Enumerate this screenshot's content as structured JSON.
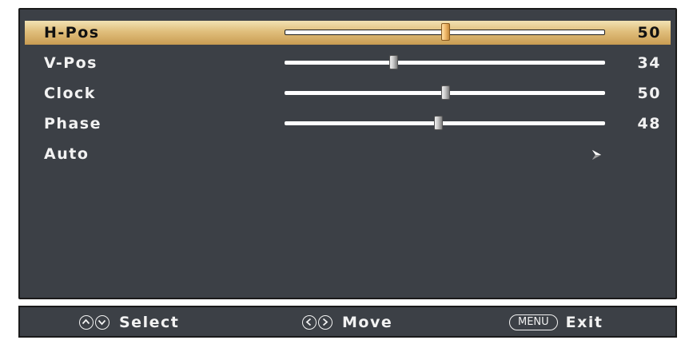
{
  "menu": {
    "rows": [
      {
        "label": "H-Pos",
        "value": "50",
        "level": 50,
        "type": "slider",
        "selected": true
      },
      {
        "label": "V-Pos",
        "value": "34",
        "level": 34,
        "type": "slider",
        "selected": false
      },
      {
        "label": "Clock",
        "value": "50",
        "level": 50,
        "type": "slider",
        "selected": false
      },
      {
        "label": "Phase",
        "value": "48",
        "level": 48,
        "type": "slider",
        "selected": false
      },
      {
        "label": "Auto",
        "type": "submenu",
        "icon": "chevron-right-icon",
        "selected": false
      }
    ]
  },
  "footer": {
    "select_label": "Select",
    "select_icons": [
      "up-arrow-icon",
      "down-arrow-icon"
    ],
    "move_label": "Move",
    "move_icons": [
      "left-arrow-icon",
      "right-arrow-icon"
    ],
    "menu_key": "MENU",
    "exit_label": "Exit"
  },
  "colors": {
    "panel": "#3c4046",
    "highlight": "#e0be7c",
    "text": "#f2f2f2"
  }
}
